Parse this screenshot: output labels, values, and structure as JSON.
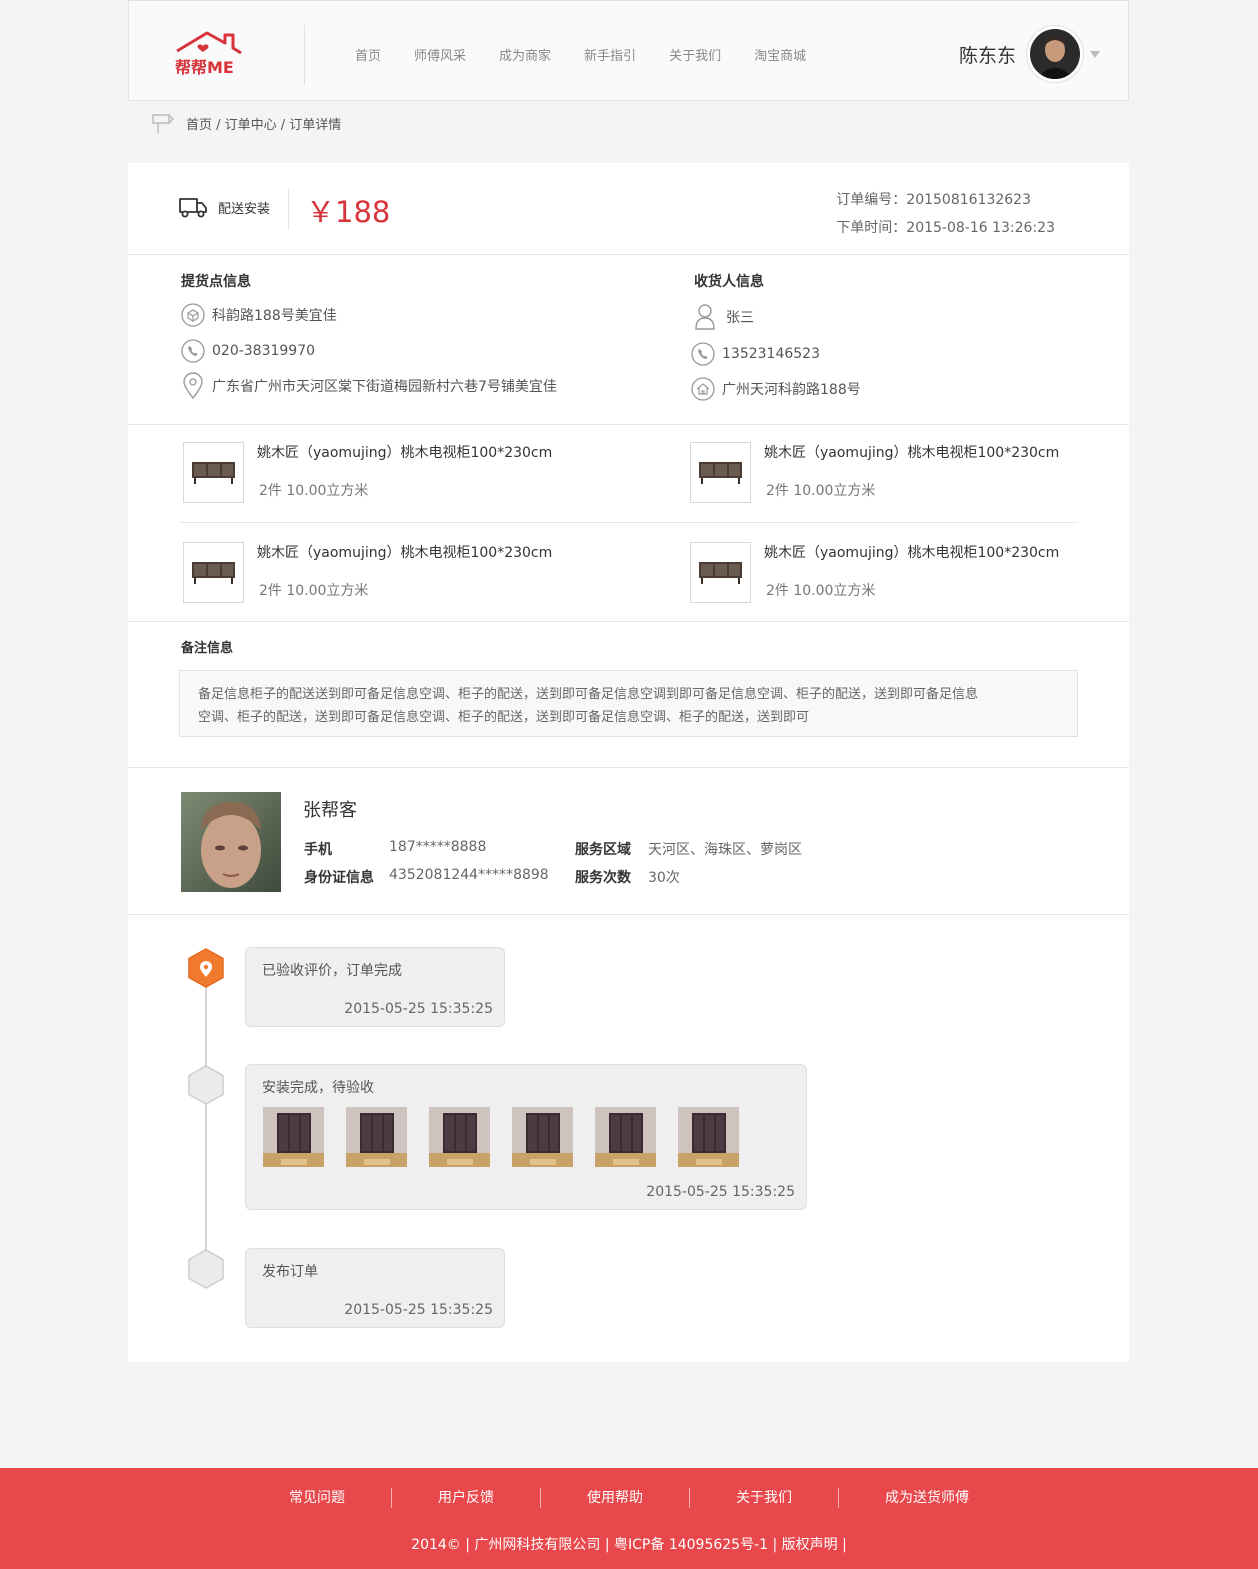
{
  "header": {
    "logo_text": "帮帮ME",
    "nav": [
      "首页",
      "师傅风采",
      "成为商家",
      "新手指引",
      "关于我们",
      "淘宝商城"
    ],
    "user_name": "陈东东"
  },
  "breadcrumb": "首页 / 订单中心 / 订单详情",
  "order": {
    "service_type": "配送安装",
    "price": "￥188",
    "order_no": "订单编号：20150816132623",
    "order_time": "下单时间：2015-08-16 13:26:23"
  },
  "pickup": {
    "title": "提货点信息",
    "store": "科韵路188号美宜佳",
    "phone": "020-38319970",
    "address": "广东省广州市天河区棠下街道梅园新村六巷7号铺美宜佳"
  },
  "receiver": {
    "title": "收货人信息",
    "name": "张三",
    "phone": "13523146523",
    "address": "广州天河科韵路188号"
  },
  "products": [
    {
      "name": "姚木匠（yaomujing）桃木电视柜100*230cm",
      "qty": "2件  10.00立方米"
    },
    {
      "name": "姚木匠（yaomujing）桃木电视柜100*230cm",
      "qty": "2件  10.00立方米"
    },
    {
      "name": "姚木匠（yaomujing）桃木电视柜100*230cm",
      "qty": "2件  10.00立方米"
    },
    {
      "name": "姚木匠（yaomujing）桃木电视柜100*230cm",
      "qty": "2件  10.00立方米"
    }
  ],
  "remark": {
    "title": "备注信息",
    "line1": "备足信息柜子的配送送到即可备足信息空调、柜子的配送，送到即可备足信息空调到即可备足信息空调、柜子的配送，送到即可备足信息",
    "line2": "空调、柜子的配送，送到即可备足信息空调、柜子的配送，送到即可备足信息空调、柜子的配送，送到即可"
  },
  "worker": {
    "name": "张帮客",
    "phone_label": "手机",
    "phone": "187*****8888",
    "id_label": "身份证信息",
    "id": "4352081244*****8898",
    "area_label": "服务区域",
    "area": "天河区、海珠区、萝岗区",
    "count_label": "服务次数",
    "count": "30次"
  },
  "timeline": [
    {
      "text": "已验收评价，订单完成",
      "time": "2015-05-25 15:35:25",
      "active": true
    },
    {
      "text": "安装完成，待验收",
      "time": "2015-05-25 15:35:25",
      "photos": 6
    },
    {
      "text": "发布订单",
      "time": "2015-05-25 15:35:25"
    }
  ],
  "footer": {
    "links": [
      "常见问题",
      "用户反馈",
      "使用帮助",
      "关于我们",
      "成为送货师傅"
    ],
    "copyright": "2014©  |  广州网科技有限公司  |  粤ICP备 14095625号-1  |  版权声明  |"
  },
  "colors": {
    "accent": "#d8333a",
    "footer": "#e8474b",
    "timeline_active": "#f07b2f"
  }
}
